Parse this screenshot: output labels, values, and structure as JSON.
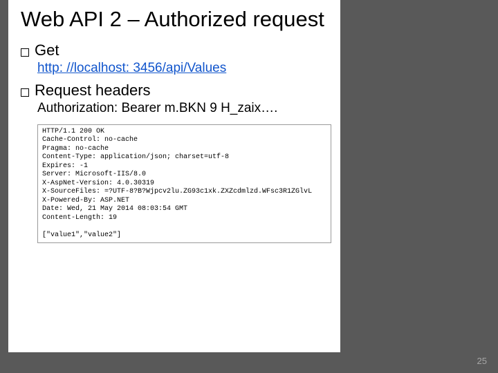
{
  "slide": {
    "title": "Web API 2 – Authorized request",
    "bullets": [
      {
        "label": "Get",
        "sub_link": "http: //localhost: 3456/api/Values"
      },
      {
        "label": "Request headers",
        "sub_text": "Authorization: Bearer m.BKN 9 H_zaix…."
      }
    ],
    "response_lines": [
      "HTTP/1.1 200 OK",
      "Cache-Control: no-cache",
      "Pragma: no-cache",
      "Content-Type: application/json; charset=utf-8",
      "Expires: -1",
      "Server: Microsoft-IIS/8.0",
      "X-AspNet-Version: 4.0.30319",
      "X-SourceFiles: =?UTF-8?B?Wjpcv2lu.ZG93c1xk.ZXZcdmlzd.WFsc3R1ZGlvL",
      "X-Powered-By: ASP.NET",
      "Date: Wed, 21 May 2014 08:03:54 GMT",
      "Content-Length: 19",
      "",
      "[\"value1\",\"value2\"]"
    ],
    "page_number": "25"
  }
}
